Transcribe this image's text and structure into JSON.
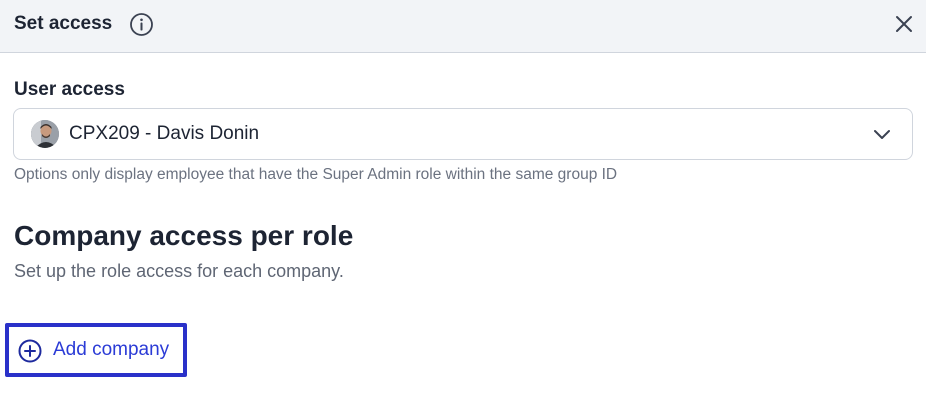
{
  "header": {
    "title": "Set access",
    "info_icon": "info-icon",
    "close_icon": "close-icon"
  },
  "user_access": {
    "label": "User access",
    "selected_value": "CPX209 - Davis Donin",
    "avatar_icon": "user-avatar",
    "dropdown_icon": "chevron-down-icon",
    "helper_text": "Options only display employee that have the Super Admin role within the same group ID"
  },
  "company_access": {
    "title": "Company access per role",
    "subtitle": "Set up the role access for each company.",
    "add_button_label": "Add company",
    "add_icon": "plus-circle-icon"
  },
  "colors": {
    "header_bg": "#f2f4f7",
    "accent": "#2b3bd6",
    "highlight_border": "#2a31c9"
  }
}
